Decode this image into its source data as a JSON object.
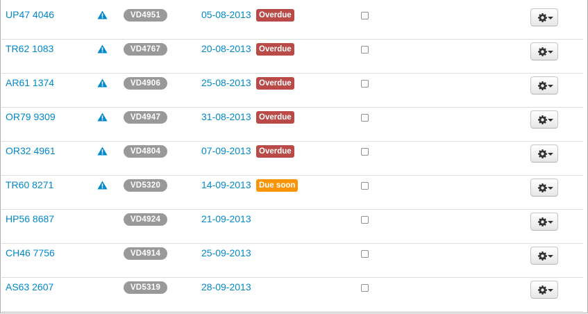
{
  "colors": {
    "link": "#0088cc",
    "overdue": "#b94a48",
    "due_soon": "#f89406",
    "id_badge": "#999999",
    "row_border": "#dddddd"
  },
  "rows": [
    {
      "registration": "UP47 4046",
      "warning": true,
      "vehicle_id": "VD4951",
      "date": "05-08-2013",
      "status": "Overdue",
      "status_type": "overdue",
      "checked": false
    },
    {
      "registration": "TR62 1083",
      "warning": true,
      "vehicle_id": "VD4767",
      "date": "20-08-2013",
      "status": "Overdue",
      "status_type": "overdue",
      "checked": false
    },
    {
      "registration": "AR61 1374",
      "warning": true,
      "vehicle_id": "VD4906",
      "date": "25-08-2013",
      "status": "Overdue",
      "status_type": "overdue",
      "checked": false
    },
    {
      "registration": "OR79 9309",
      "warning": true,
      "vehicle_id": "VD4947",
      "date": "31-08-2013",
      "status": "Overdue",
      "status_type": "overdue",
      "checked": false
    },
    {
      "registration": "OR32 4961",
      "warning": true,
      "vehicle_id": "VD4804",
      "date": "07-09-2013",
      "status": "Overdue",
      "status_type": "overdue",
      "checked": false
    },
    {
      "registration": "TR60 8271",
      "warning": true,
      "vehicle_id": "VD5320",
      "date": "14-09-2013",
      "status": "Due soon",
      "status_type": "due-soon",
      "checked": false
    },
    {
      "registration": "HP56 8687",
      "warning": false,
      "vehicle_id": "VD4924",
      "date": "21-09-2013",
      "status": "",
      "status_type": "none",
      "checked": false
    },
    {
      "registration": "CH46 7756",
      "warning": false,
      "vehicle_id": "VD4914",
      "date": "25-09-2013",
      "status": "",
      "status_type": "none",
      "checked": false
    },
    {
      "registration": "AS63 2607",
      "warning": false,
      "vehicle_id": "VD5319",
      "date": "28-09-2013",
      "status": "",
      "status_type": "none",
      "checked": false
    }
  ],
  "icons": {
    "warning": "warning-triangle-icon",
    "actions": "gear-icon",
    "caret": "caret-down-icon"
  }
}
